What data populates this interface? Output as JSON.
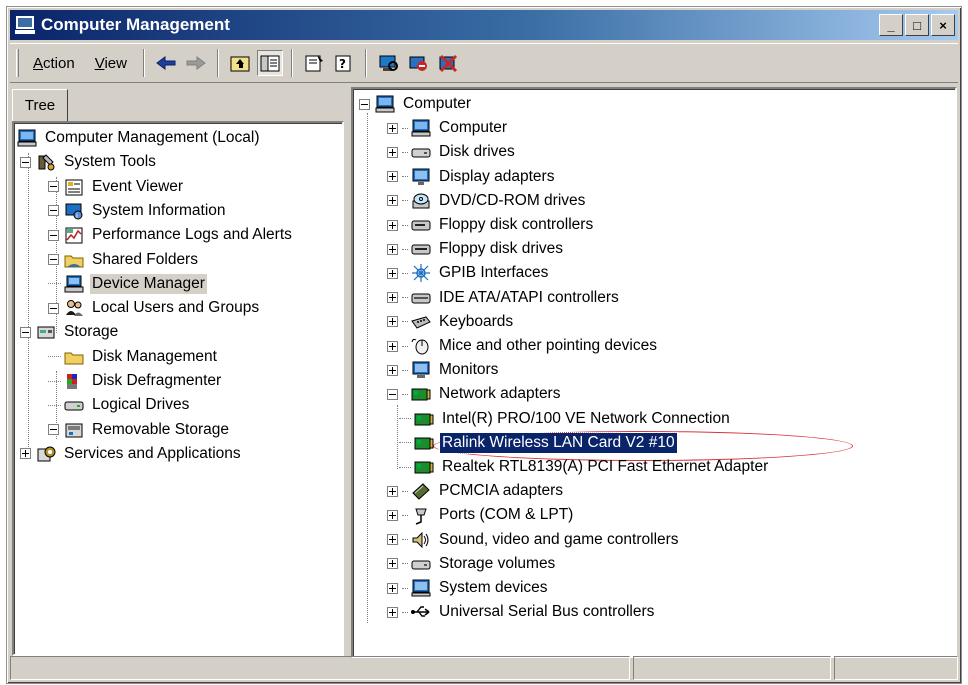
{
  "window": {
    "title": "Computer Management",
    "controls": [
      "_",
      "□",
      "×"
    ]
  },
  "menu": {
    "action": {
      "key": "A",
      "rest": "ction"
    },
    "view": {
      "key": "V",
      "rest": "iew"
    }
  },
  "toolbar": {
    "icons": [
      "back-icon",
      "forward-icon",
      "up-level-icon",
      "show-hide-tree-icon",
      "properties-icon",
      "help-icon",
      "scan-hardware-icon",
      "disable-device-icon",
      "uninstall-device-icon"
    ]
  },
  "left_tab": {
    "label": "Tree"
  },
  "left_tree": [
    {
      "label": "Computer Management (Local)",
      "icon": "computer-icon"
    },
    {
      "label": "System Tools",
      "icon": "tools-icon"
    },
    {
      "label": "Event Viewer",
      "icon": "event-viewer-icon"
    },
    {
      "label": "System Information",
      "icon": "system-info-icon"
    },
    {
      "label": "Performance Logs and Alerts",
      "icon": "performance-icon"
    },
    {
      "label": "Shared Folders",
      "icon": "shared-folder-icon"
    },
    {
      "label": "Device Manager",
      "icon": "device-manager-icon",
      "selected": true
    },
    {
      "label": "Local Users and Groups",
      "icon": "users-icon"
    },
    {
      "label": "Storage",
      "icon": "storage-icon"
    },
    {
      "label": "Disk Management",
      "icon": "disk-management-icon"
    },
    {
      "label": "Disk Defragmenter",
      "icon": "defragmenter-icon"
    },
    {
      "label": "Logical Drives",
      "icon": "logical-drive-icon"
    },
    {
      "label": "Removable Storage",
      "icon": "removable-storage-icon"
    },
    {
      "label": "Services and Applications",
      "icon": "services-icon"
    }
  ],
  "right_tree": {
    "root": {
      "label": "Computer",
      "icon": "computer-icon"
    },
    "items": [
      {
        "label": "Computer",
        "icon": "computer-icon"
      },
      {
        "label": "Disk drives",
        "icon": "disk-drive-icon"
      },
      {
        "label": "Display adapters",
        "icon": "display-icon"
      },
      {
        "label": "DVD/CD-ROM drives",
        "icon": "cdrom-icon"
      },
      {
        "label": "Floppy disk controllers",
        "icon": "floppy-controller-icon"
      },
      {
        "label": "Floppy disk drives",
        "icon": "floppy-drive-icon"
      },
      {
        "label": "GPIB Interfaces",
        "icon": "gpib-icon"
      },
      {
        "label": "IDE ATA/ATAPI controllers",
        "icon": "ide-controller-icon"
      },
      {
        "label": "Keyboards",
        "icon": "keyboard-icon"
      },
      {
        "label": "Mice and other pointing devices",
        "icon": "mouse-icon"
      },
      {
        "label": "Monitors",
        "icon": "monitor-icon"
      },
      {
        "label": "Network adapters",
        "icon": "network-adapter-icon",
        "expanded": true
      },
      {
        "label": "Intel(R) PRO/100 VE Network Connection",
        "icon": "network-card-icon",
        "child": true
      },
      {
        "label": "Ralink Wireless LAN Card V2 #10",
        "icon": "network-card-icon",
        "child": true,
        "selected": true
      },
      {
        "label": "Realtek RTL8139(A) PCI Fast Ethernet Adapter",
        "icon": "network-card-icon",
        "child": true
      },
      {
        "label": "PCMCIA adapters",
        "icon": "pcmcia-icon"
      },
      {
        "label": "Ports (COM & LPT)",
        "icon": "port-icon"
      },
      {
        "label": "Sound, video and game controllers",
        "icon": "sound-icon"
      },
      {
        "label": "Storage volumes",
        "icon": "storage-volume-icon"
      },
      {
        "label": "System devices",
        "icon": "system-device-icon"
      },
      {
        "label": "Universal Serial Bus controllers",
        "icon": "usb-icon"
      }
    ]
  },
  "colors": {
    "selection": "#0a246a",
    "title_gradient_start": "#0a246a",
    "highlight_ellipse": "#d9363e"
  },
  "statusbar": {
    "panels": [
      "",
      "",
      ""
    ]
  }
}
